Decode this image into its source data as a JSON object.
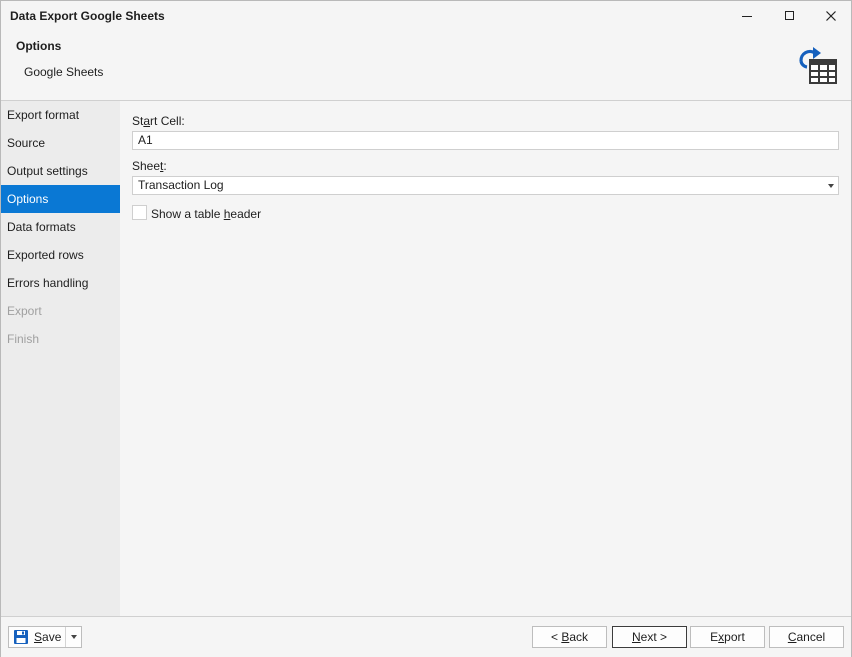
{
  "window": {
    "title": "Data Export Google Sheets",
    "controls": [
      "minimize-icon",
      "maximize-icon",
      "close-icon"
    ]
  },
  "header": {
    "title": "Options",
    "subtitle": "Google Sheets",
    "icon": "google-sheets-export-icon"
  },
  "sidebar": {
    "items": [
      {
        "label": "Export format",
        "state": "normal"
      },
      {
        "label": "Source",
        "state": "normal"
      },
      {
        "label": "Output settings",
        "state": "normal"
      },
      {
        "label": "Options",
        "state": "active"
      },
      {
        "label": "Data formats",
        "state": "normal"
      },
      {
        "label": "Exported rows",
        "state": "normal"
      },
      {
        "label": "Errors handling",
        "state": "normal"
      },
      {
        "label": "Export",
        "state": "disabled"
      },
      {
        "label": "Finish",
        "state": "disabled"
      }
    ]
  },
  "form": {
    "start_cell_label_pre": "St",
    "start_cell_label_key": "a",
    "start_cell_label_post": "rt Cell:",
    "start_cell_value": "A1",
    "sheet_label_pre": "Shee",
    "sheet_label_key": "t",
    "sheet_label_post": ":",
    "sheet_value": "Transaction Log",
    "header_checkbox_pre": "Show a table ",
    "header_checkbox_key": "h",
    "header_checkbox_post": "eader",
    "header_checkbox_checked": false
  },
  "footer": {
    "save_key": "S",
    "save_rest": "ave",
    "back_pre": "< ",
    "back_key": "B",
    "back_rest": "ack",
    "next_key": "N",
    "next_rest": "ext >",
    "export_pre": "E",
    "export_key": "x",
    "export_rest": "port",
    "cancel_key": "C",
    "cancel_rest": "ancel"
  },
  "colors": {
    "accent": "#0a78d4",
    "icon_blue": "#1560bd",
    "icon_dark": "#3b3b3b"
  }
}
